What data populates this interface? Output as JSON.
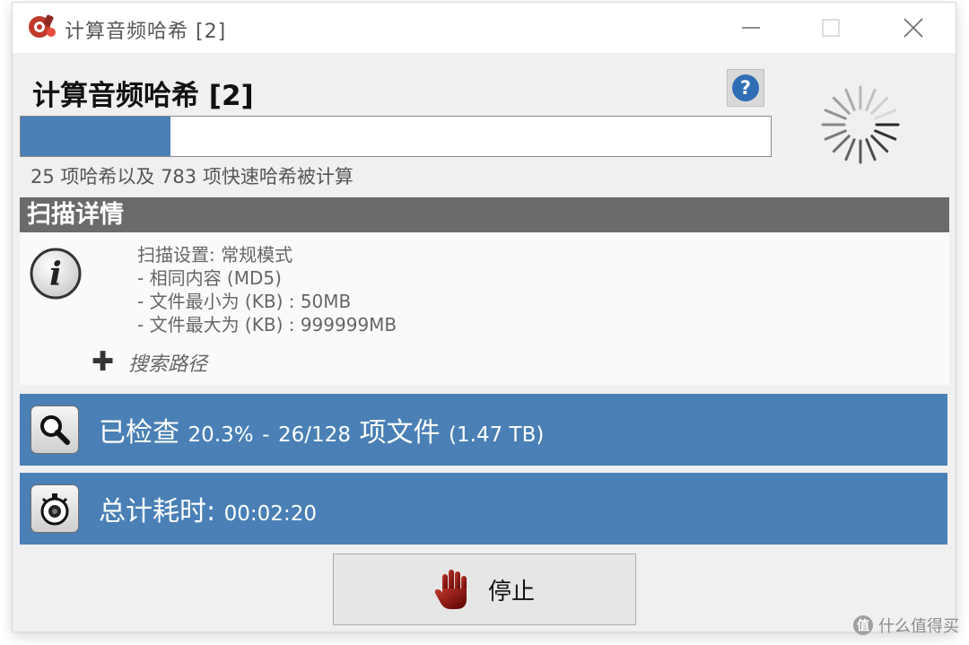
{
  "window": {
    "title": "计算音频哈希 [2]"
  },
  "header": {
    "heading": "计算音频哈希 [2]",
    "help_icon": "question-mark-icon",
    "spinner_icon": "busy-spinner-icon"
  },
  "progress": {
    "fraction": 0.2,
    "status_text": "25 项哈希以及 783 项快速哈希被计算"
  },
  "details": {
    "section_title": "扫描详情",
    "info_icon": "info-icon",
    "settings": [
      "扫描设置: 常规模式",
      "- 相同内容 (MD5)",
      "- 文件最小为 (KB) : 50MB",
      "- 文件最大为 (KB) : 999999MB"
    ],
    "search_path_label": "搜索路径"
  },
  "checked": {
    "label": "已检查",
    "percent": "20.3%",
    "separator": "-",
    "count": "26/128",
    "items_label": "项文件",
    "size": "(1.47 TB)"
  },
  "elapsed": {
    "label": "总计耗时:",
    "value": "00:02:20"
  },
  "stop_button": {
    "label": "停止"
  },
  "watermark": {
    "text": "什么值得买",
    "badge": "值"
  },
  "colors": {
    "accent_blue": "#4a80b5",
    "section_gray": "#6b6b6b",
    "stop_hand": "#8b0f0f"
  }
}
